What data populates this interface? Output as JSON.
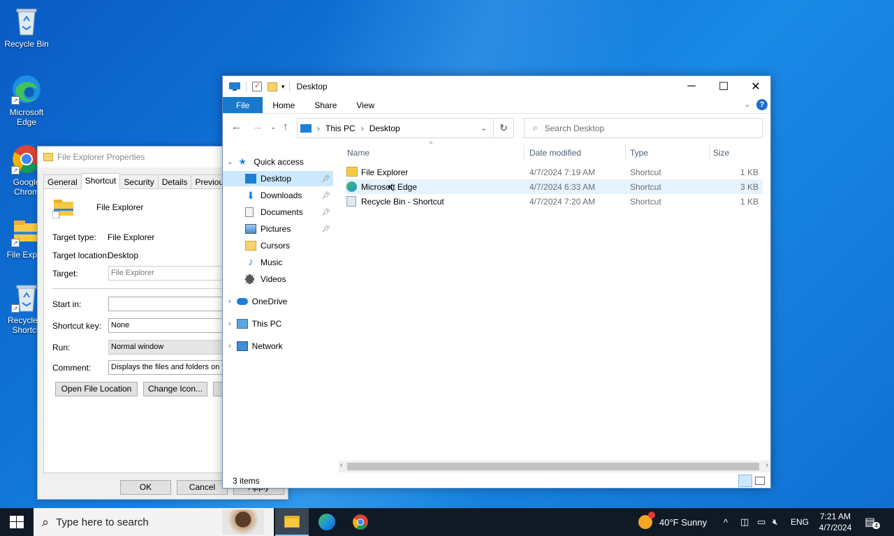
{
  "desktop": {
    "icons": [
      {
        "label": "Recycle Bin",
        "icon": "recycle-bin-icon"
      },
      {
        "label": "Microsoft Edge",
        "icon": "edge-icon"
      },
      {
        "label": "Google Chrome",
        "icon": "chrome-icon"
      },
      {
        "label": "File Explorer",
        "icon": "folder-icon"
      },
      {
        "label": "Recycle Bin - Shortcut",
        "icon": "recycle-bin-icon"
      }
    ],
    "labels": {
      "recycle": "Recycle Bin",
      "edge_l1": "Microsoft",
      "edge_l2": "Edge",
      "chrome_l1": "Google",
      "chrome_l2": "Chrom",
      "fe": "File Explor",
      "rb_l1": "Recycle B",
      "rb_l2": "Shortcu"
    }
  },
  "properties": {
    "title": "File Explorer Properties",
    "tabs": [
      "General",
      "Shortcut",
      "Security",
      "Details",
      "Previous Ve"
    ],
    "active_tab": "Shortcut",
    "name": "File Explorer",
    "target_type_label": "Target type:",
    "target_type": "File Explorer",
    "target_location_label": "Target location:",
    "target_location": "Desktop",
    "target_label": "Target:",
    "target_value": "File Explorer",
    "start_in_label": "Start in:",
    "start_in_value": "",
    "shortcut_key_label": "Shortcut key:",
    "shortcut_key_value": "None",
    "run_label": "Run:",
    "run_value": "Normal window",
    "comment_label": "Comment:",
    "comment_value": "Displays the files and folders on yo",
    "open_location_btn": "Open File Location",
    "change_icon_btn": "Change Icon...",
    "ok_btn": "OK",
    "cancel_btn": "Cancel",
    "apply_btn": "Apply"
  },
  "explorer": {
    "title": "Desktop",
    "ribbon_tabs": {
      "file": "File",
      "home": "Home",
      "share": "Share",
      "view": "View"
    },
    "breadcrumb": {
      "root": "This PC",
      "current": "Desktop"
    },
    "search_placeholder": "Search Desktop",
    "nav": {
      "quick_access": "Quick access",
      "desktop": "Desktop",
      "downloads": "Downloads",
      "documents": "Documents",
      "pictures": "Pictures",
      "cursors": "Cursors",
      "music": "Music",
      "videos": "Videos",
      "onedrive": "OneDrive",
      "this_pc": "This PC",
      "network": "Network"
    },
    "columns": {
      "name": "Name",
      "date": "Date modified",
      "type": "Type",
      "size": "Size"
    },
    "files": [
      {
        "name": "File Explorer",
        "date": "4/7/2024 7:19 AM",
        "type": "Shortcut",
        "size": "1 KB"
      },
      {
        "name": "Microsoft Edge",
        "date": "4/7/2024 6:33 AM",
        "type": "Shortcut",
        "size": "3 KB"
      },
      {
        "name": "Recycle Bin - Shortcut",
        "date": "4/7/2024 7:20 AM",
        "type": "Shortcut",
        "size": "1 KB"
      }
    ],
    "status": "3 items"
  },
  "taskbar": {
    "search_placeholder": "Type here to search",
    "weather": "40°F  Sunny",
    "language": "ENG",
    "time": "7:21 AM",
    "date": "4/7/2024",
    "notification_count": "4"
  }
}
